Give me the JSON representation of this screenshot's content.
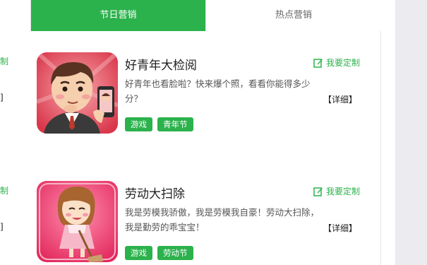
{
  "tabs": {
    "active_label": "节日营销",
    "inactive_label": "热点营销"
  },
  "left_partial": {
    "edit_text": "制",
    "detail_text": "]"
  },
  "cards": [
    {
      "title": "好青年大检阅",
      "edit_label": "我要定制",
      "description": "好青年也看脸啦？快来爆个照，看看你能得多少分？",
      "detail_label": "【详细】",
      "tags": [
        "游戏",
        "青年节"
      ],
      "thumb_icon": "cartoon-young-man-thumbnail"
    },
    {
      "title": "劳动大扫除",
      "edit_label": "我要定制",
      "description": "我是劳模我骄傲，我是劳模我自豪！劳动大扫除，我是勤劳的乖宝宝！",
      "detail_label": "【详细】",
      "tags": [
        "游戏",
        "劳动节"
      ],
      "thumb_icon": "cartoon-girl-sweeping-thumbnail"
    }
  ],
  "colors": {
    "brand_green": "#2bb24c",
    "side_panel": "#ececf0"
  }
}
